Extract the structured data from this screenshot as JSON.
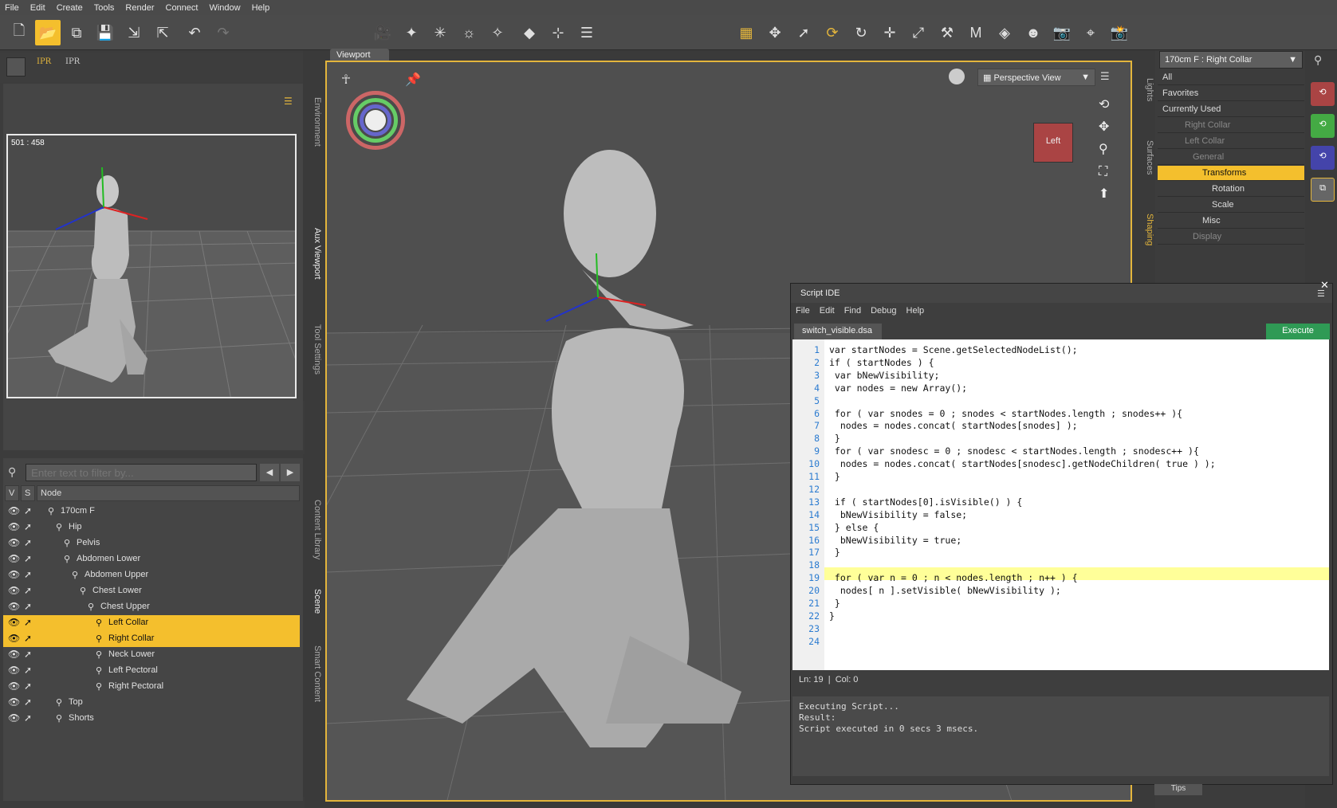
{
  "menu": [
    "File",
    "Edit",
    "Create",
    "Tools",
    "Render",
    "Connect",
    "Window",
    "Help"
  ],
  "aux": {
    "ipr1": "IPR",
    "ipr2": "IPR",
    "dims": "501 : 458"
  },
  "left_vtabs": [
    "Environment",
    "Aux Viewport",
    "Tool Settings"
  ],
  "left_vtabs2": [
    "Content Library",
    "Scene",
    "Smart Content"
  ],
  "scene": {
    "filter_placeholder": "Enter text to filter by...",
    "col_v": "V",
    "col_s": "S",
    "col_node": "Node",
    "rows": [
      {
        "label": "170cm F",
        "indent": 0,
        "sel": false
      },
      {
        "label": "Hip",
        "indent": 1,
        "sel": false
      },
      {
        "label": "Pelvis",
        "indent": 2,
        "sel": false
      },
      {
        "label": "Abdomen Lower",
        "indent": 2,
        "sel": false
      },
      {
        "label": "Abdomen Upper",
        "indent": 3,
        "sel": false
      },
      {
        "label": "Chest Lower",
        "indent": 4,
        "sel": false
      },
      {
        "label": "Chest Upper",
        "indent": 5,
        "sel": false
      },
      {
        "label": "Left Collar",
        "indent": 6,
        "sel": true
      },
      {
        "label": "Right Collar",
        "indent": 6,
        "sel": true
      },
      {
        "label": "Neck Lower",
        "indent": 6,
        "sel": false
      },
      {
        "label": "Left Pectoral",
        "indent": 6,
        "sel": false
      },
      {
        "label": "Right Pectoral",
        "indent": 6,
        "sel": false
      },
      {
        "label": "Top",
        "indent": 1,
        "sel": false
      },
      {
        "label": "Shorts",
        "indent": 1,
        "sel": false
      }
    ]
  },
  "viewport": {
    "tab": "Viewport",
    "view": "Perspective View",
    "cube": "Left"
  },
  "right_vtabs": [
    "Lights",
    "Surfaces",
    "Shaping"
  ],
  "params": {
    "node": "170cm F : Right Collar",
    "items": [
      "All",
      "Favorites",
      "Currently Used",
      "Right Collar",
      "Left Collar",
      "General",
      "Transforms",
      "Rotation",
      "Scale",
      "Misc",
      "Display"
    ]
  },
  "script": {
    "title": "Script IDE",
    "menu": [
      "File",
      "Edit",
      "Find",
      "Debug",
      "Help"
    ],
    "file": "switch_visible.dsa",
    "execute": "Execute",
    "status_ln": "Ln: 19",
    "status_col": "Col:  0",
    "lines": [
      "var startNodes = Scene.getSelectedNodeList();",
      "if ( startNodes ) {",
      " var bNewVisibility;",
      " var nodes = new Array();",
      "",
      " for ( var snodes = 0 ; snodes < startNodes.length ; snodes++ ){",
      "  nodes = nodes.concat( startNodes[snodes] );",
      " }",
      " for ( var snodesc = 0 ; snodesc < startNodes.length ; snodesc++ ){",
      "  nodes = nodes.concat( startNodes[snodesc].getNodeChildren( true ) );",
      " }",
      "",
      " if ( startNodes[0].isVisible() ) {",
      "  bNewVisibility = false;",
      " } else {",
      "  bNewVisibility = true;",
      " }",
      "",
      " for ( var n = 0 ; n < nodes.length ; n++ ) {",
      "  nodes[ n ].setVisible( bNewVisibility );",
      " }",
      "}",
      "",
      ""
    ],
    "output": [
      "Executing Script...",
      "Result:",
      "Script executed in 0 secs 3 msecs."
    ]
  },
  "tips": "Tips"
}
